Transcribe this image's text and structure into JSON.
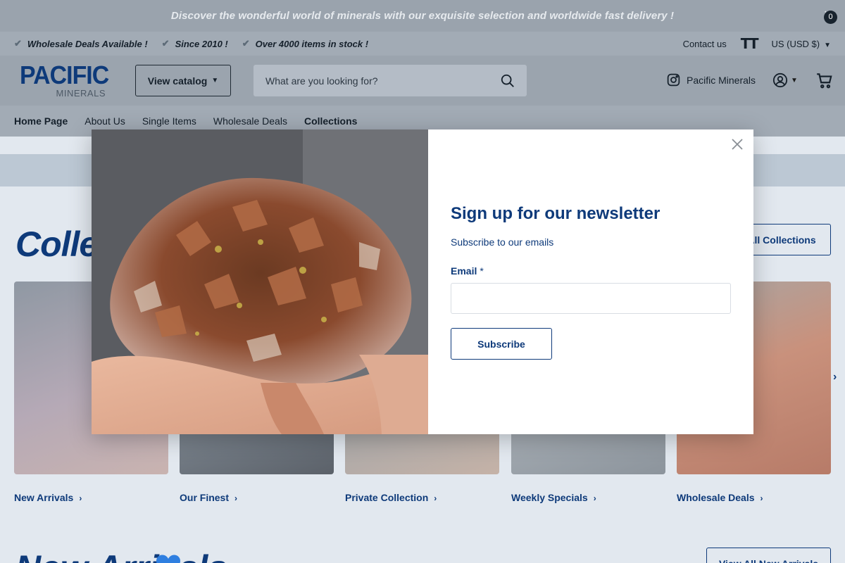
{
  "announcement": {
    "text": "Discover the wonderful world of minerals with our exquisite selection and worldwide fast delivery !"
  },
  "usps": [
    {
      "label": "Wholesale Deals Available !"
    },
    {
      "label": "Since 2010 !"
    },
    {
      "label": "Over 4000 items in stock !"
    }
  ],
  "utility": {
    "contact": "Contact us",
    "currency": "US (USD $)"
  },
  "header": {
    "logo_main": "PACIFIC",
    "logo_sub": "MINERALS",
    "catalog_label": "View catalog",
    "search_placeholder": "What are you looking for?",
    "instagram_label": "Pacific Minerals",
    "cart_count": "0"
  },
  "nav": [
    {
      "label": "Home Page"
    },
    {
      "label": "About Us"
    },
    {
      "label": "Single Items"
    },
    {
      "label": "Wholesale Deals"
    },
    {
      "label": "Collections"
    }
  ],
  "collections": {
    "title": "Collections",
    "view_all": "View All Collections",
    "cards": [
      {
        "label": "New Arrivals"
      },
      {
        "label": "Our Finest"
      },
      {
        "label": "Private Collection"
      },
      {
        "label": "Weekly Specials"
      },
      {
        "label": "Wholesale Deals"
      }
    ]
  },
  "new_arrivals": {
    "title": "New Arrivals",
    "view_all": "View All New Arrivals"
  },
  "newsletter": {
    "title": "Sign up for our newsletter",
    "subtitle": "Subscribe to our emails",
    "email_label": "Email",
    "required_mark": "*",
    "email_value": "",
    "subscribe_label": "Subscribe"
  },
  "colors": {
    "brand": "#0e3a7a",
    "overlay": "#9ba4ae"
  }
}
